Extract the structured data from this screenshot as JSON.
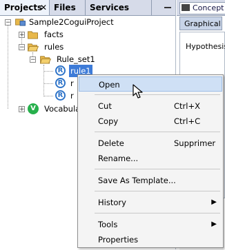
{
  "left_tabs": [
    {
      "label": "Projects",
      "close": "✕",
      "active": true
    },
    {
      "label": "Files",
      "active": false
    },
    {
      "label": "Services",
      "active": false
    }
  ],
  "tree": {
    "project": "Sample2CoguiProject",
    "facts": "facts",
    "rules": "rules",
    "rule_set": "Rule_set1",
    "rule1": "rule1",
    "rule2": "r",
    "rule3": "r",
    "vocabulary": "Vocabula",
    "rule_icon_letter": "R",
    "vocab_icon_letter": "V"
  },
  "right_panel": {
    "doc_tab": "Concept t",
    "subtab": "Graphical",
    "hypothesis": "Hypothesis"
  },
  "context_menu": {
    "items": [
      {
        "label": "Open",
        "shortcut": "",
        "submenu": false
      },
      {
        "label": "Cut",
        "shortcut": "Ctrl+X",
        "submenu": false
      },
      {
        "label": "Copy",
        "shortcut": "Ctrl+C",
        "submenu": false
      },
      {
        "label": "Delete",
        "shortcut": "Supprimer",
        "submenu": false
      },
      {
        "label": "Rename...",
        "shortcut": "",
        "submenu": false
      },
      {
        "label": "Save As Template...",
        "shortcut": "",
        "submenu": false
      },
      {
        "label": "History",
        "shortcut": "",
        "submenu": true
      },
      {
        "label": "Tools",
        "shortcut": "",
        "submenu": true
      },
      {
        "label": "Properties",
        "shortcut": "",
        "submenu": false
      }
    ]
  },
  "colors": {
    "selection": "#3d7bd8",
    "menu_hover": "#cfe0f5",
    "rule_icon": "#2d73c8",
    "vocab_icon": "#27b04c",
    "folder": "#e8b84a"
  }
}
